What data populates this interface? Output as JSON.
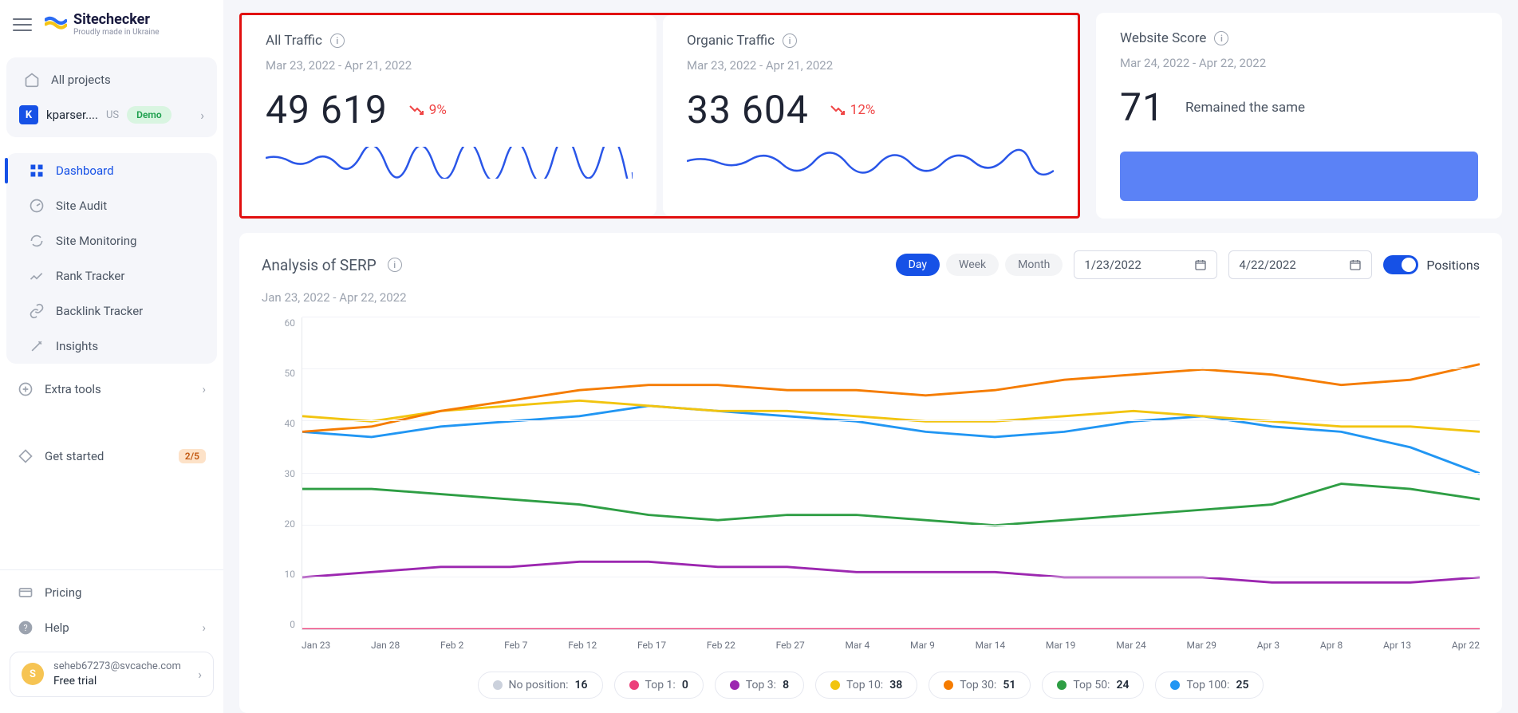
{
  "brand": {
    "name": "Sitechecker",
    "tagline": "Proudly made in Ukraine"
  },
  "sidebar": {
    "all_projects": "All projects",
    "project": {
      "initial": "K",
      "name": "kparser....",
      "locale": "US",
      "demo": "Demo"
    },
    "nav": [
      {
        "label": "Dashboard"
      },
      {
        "label": "Site Audit"
      },
      {
        "label": "Site Monitoring"
      },
      {
        "label": "Rank Tracker"
      },
      {
        "label": "Backlink Tracker"
      },
      {
        "label": "Insights"
      }
    ],
    "extra_tools": "Extra tools",
    "get_started": {
      "label": "Get started",
      "progress": "2/5"
    },
    "pricing": "Pricing",
    "help": "Help",
    "user": {
      "initial": "S",
      "email": "seheb67273@svcache.com",
      "plan": "Free trial"
    }
  },
  "cards": {
    "all_traffic": {
      "title": "All Traffic",
      "range": "Mar 23, 2022 - Apr 21, 2022",
      "value": "49 619",
      "trend": "9%"
    },
    "organic_traffic": {
      "title": "Organic Traffic",
      "range": "Mar 23, 2022 - Apr 21, 2022",
      "value": "33 604",
      "trend": "12%"
    },
    "score": {
      "title": "Website Score",
      "range": "Mar 24, 2022 - Apr 22, 2022",
      "value": "71",
      "status": "Remained the same"
    }
  },
  "serp": {
    "title": "Analysis of SERP",
    "range_text": "Jan 23, 2022 - Apr 22, 2022",
    "view": {
      "day": "Day",
      "week": "Week",
      "month": "Month"
    },
    "date_from": "1/23/2022",
    "date_to": "4/22/2022",
    "switch_label": "Positions",
    "x_ticks": [
      "Jan 23",
      "Jan 28",
      "Feb 2",
      "Feb 7",
      "Feb 12",
      "Feb 17",
      "Feb 22",
      "Feb 27",
      "Mar 4",
      "Mar 9",
      "Mar 14",
      "Mar 19",
      "Mar 24",
      "Mar 29",
      "Apr 3",
      "Apr 8",
      "Apr 13",
      "Apr 22"
    ],
    "legend": [
      {
        "label": "No position:",
        "value": "16",
        "color": "#cbd1dc"
      },
      {
        "label": "Top 1:",
        "value": "0",
        "color": "#ec407a"
      },
      {
        "label": "Top 3:",
        "value": "8",
        "color": "#9c27b0"
      },
      {
        "label": "Top 10:",
        "value": "38",
        "color": "#f2c40f"
      },
      {
        "label": "Top 30:",
        "value": "51",
        "color": "#f57c00"
      },
      {
        "label": "Top 50:",
        "value": "24",
        "color": "#2e9e44"
      },
      {
        "label": "Top 100:",
        "value": "25",
        "color": "#2196f3"
      }
    ]
  },
  "chart_data": {
    "type": "line",
    "title": "Analysis of SERP — Positions",
    "xlabel": "",
    "ylabel": "",
    "ylim": [
      0,
      60
    ],
    "y_ticks": [
      0,
      10,
      20,
      30,
      40,
      50,
      60
    ],
    "categories": [
      "Jan 23",
      "Jan 28",
      "Feb 2",
      "Feb 7",
      "Feb 12",
      "Feb 17",
      "Feb 22",
      "Feb 27",
      "Mar 4",
      "Mar 9",
      "Mar 14",
      "Mar 19",
      "Mar 24",
      "Mar 29",
      "Apr 3",
      "Apr 8",
      "Apr 13",
      "Apr 22"
    ],
    "series": [
      {
        "name": "Top 1",
        "color": "#ec407a",
        "values": [
          0,
          0,
          0,
          0,
          0,
          0,
          0,
          0,
          0,
          0,
          0,
          0,
          0,
          0,
          0,
          0,
          0,
          0
        ]
      },
      {
        "name": "Top 3",
        "color": "#9c27b0",
        "values": [
          10,
          11,
          12,
          12,
          13,
          13,
          12,
          12,
          11,
          11,
          11,
          10,
          10,
          10,
          9,
          9,
          9,
          10
        ]
      },
      {
        "name": "Top 50",
        "color": "#2e9e44",
        "values": [
          27,
          27,
          26,
          25,
          24,
          22,
          21,
          22,
          22,
          21,
          20,
          21,
          22,
          23,
          24,
          28,
          27,
          25
        ]
      },
      {
        "name": "Top 100",
        "color": "#2196f3",
        "values": [
          38,
          37,
          39,
          40,
          41,
          43,
          42,
          41,
          40,
          38,
          37,
          38,
          40,
          41,
          39,
          38,
          35,
          30
        ]
      },
      {
        "name": "Top 10",
        "color": "#f2c40f",
        "values": [
          41,
          40,
          42,
          43,
          44,
          43,
          42,
          42,
          41,
          40,
          40,
          41,
          42,
          41,
          40,
          39,
          39,
          38
        ]
      },
      {
        "name": "Top 30",
        "color": "#f57c00",
        "values": [
          38,
          39,
          42,
          44,
          46,
          47,
          47,
          46,
          46,
          45,
          46,
          48,
          49,
          50,
          49,
          47,
          48,
          51
        ]
      }
    ]
  }
}
